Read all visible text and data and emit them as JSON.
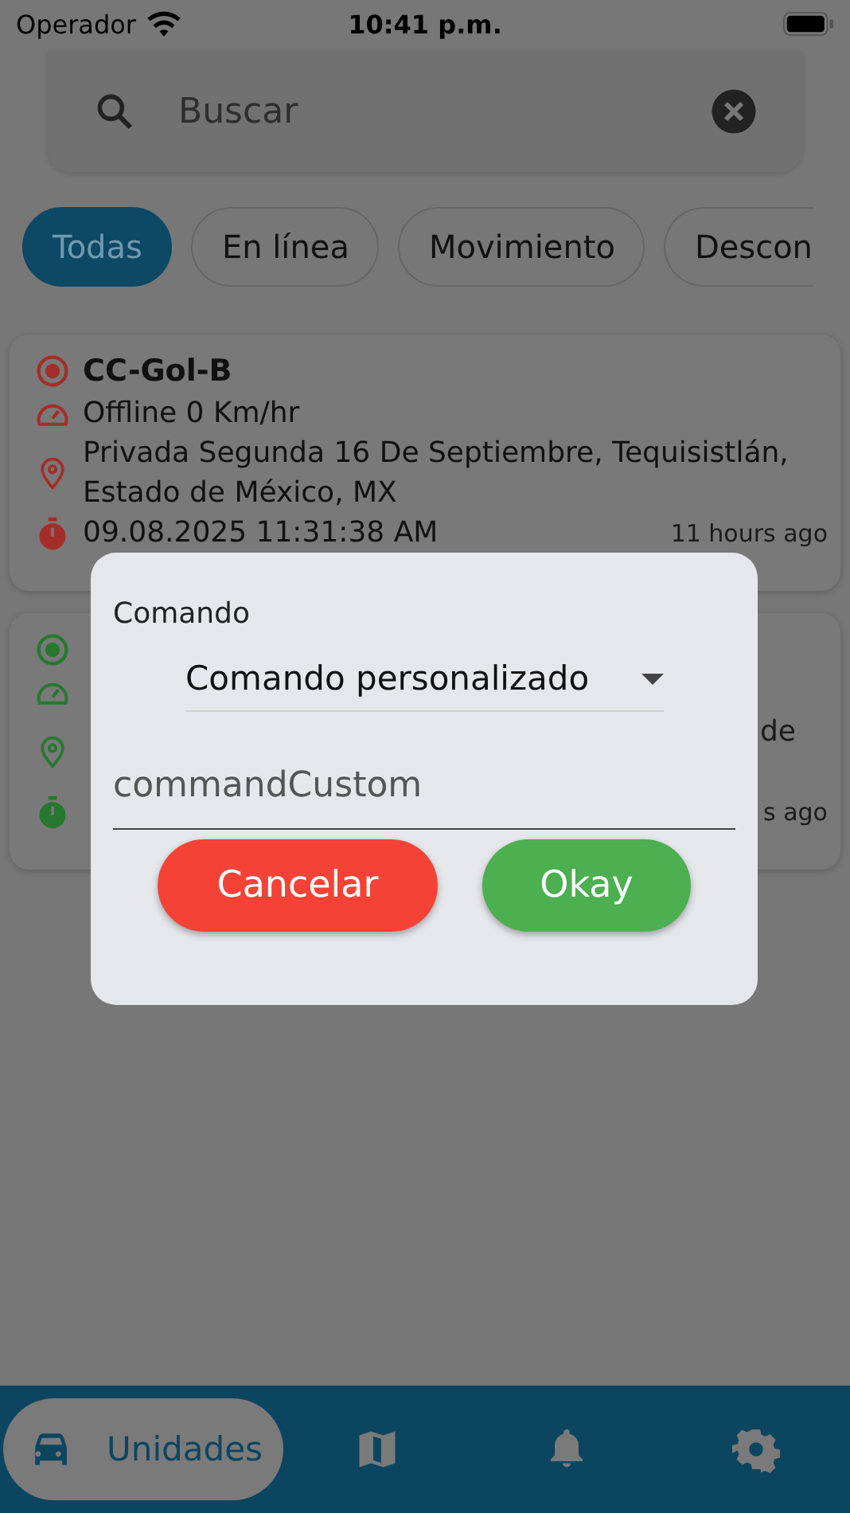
{
  "status_bar": {
    "carrier": "Operador",
    "time": "10:41 p.m."
  },
  "search": {
    "placeholder": "Buscar"
  },
  "filters": [
    {
      "label": "Todas",
      "selected": true
    },
    {
      "label": "En línea",
      "selected": false
    },
    {
      "label": "Movimiento",
      "selected": false
    },
    {
      "label": "Descon",
      "selected": false
    }
  ],
  "units": [
    {
      "name": "CC-Gol-B",
      "color": "#a52d29",
      "speed": "Offline 0 Km/hr",
      "address_lines": [
        "Privada Segunda 16 De Septiembre, Tequisistlán,",
        "Estado de México, MX"
      ],
      "time": "09.08.2025 11:31:38 AM",
      "ago": "11 hours ago"
    },
    {
      "color": "#27782f",
      "address_right": "de",
      "ago": "s ago"
    }
  ],
  "dialog": {
    "title": "Comando",
    "dropdown": "Comando personalizado",
    "input": {
      "placeholder": "commandCustom"
    },
    "buttons": [
      {
        "label": "Cancelar",
        "kind": "cancel"
      },
      {
        "label": "Okay",
        "kind": "confirm"
      }
    ]
  },
  "bottom_nav": [
    {
      "kind": "car",
      "label": "Unidades",
      "selected": true
    },
    {
      "kind": "map",
      "selected": false
    },
    {
      "kind": "bell",
      "selected": false
    },
    {
      "kind": "gear",
      "selected": false
    }
  ]
}
